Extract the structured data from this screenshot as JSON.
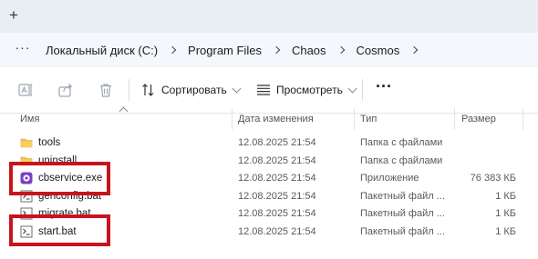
{
  "tabstrip": {
    "new_tab_label": "+"
  },
  "address": {
    "more_label": "···",
    "crumbs": [
      "Локальный диск (C:)",
      "Program Files",
      "Chaos",
      "Cosmos"
    ]
  },
  "toolbar": {
    "sort_label": "Сортировать",
    "view_label": "Просмотреть",
    "more_label": "···"
  },
  "columns": {
    "name": "Имя",
    "date": "Дата изменения",
    "type": "Тип",
    "size": "Размер"
  },
  "files": [
    {
      "icon": "folder-icon",
      "name": "tools",
      "date": "12.08.2025 21:54",
      "type": "Папка с файлами",
      "size": ""
    },
    {
      "icon": "folder-icon",
      "name": "uninstall",
      "date": "12.08.2025 21:54",
      "type": "Папка с файлами",
      "size": ""
    },
    {
      "icon": "app-icon",
      "name": "cbservice.exe",
      "date": "12.08.2025 21:54",
      "type": "Приложение",
      "size": "76 383 КБ"
    },
    {
      "icon": "batch-file-icon",
      "name": "genconfig.bat",
      "date": "12.08.2025 21:54",
      "type": "Пакетный файл ...",
      "size": "1 КБ"
    },
    {
      "icon": "batch-file-icon",
      "name": "migrate.bat",
      "date": "12.08.2025 21:54",
      "type": "Пакетный файл ...",
      "size": "1 КБ"
    },
    {
      "icon": "batch-file-icon",
      "name": "start.bat",
      "date": "12.08.2025 21:54",
      "type": "Пакетный файл ...",
      "size": "1 КБ"
    }
  ],
  "colors": {
    "highlight": "#c8141c",
    "folder": "#f2c14b",
    "app_icon": "#7b3fc4"
  }
}
